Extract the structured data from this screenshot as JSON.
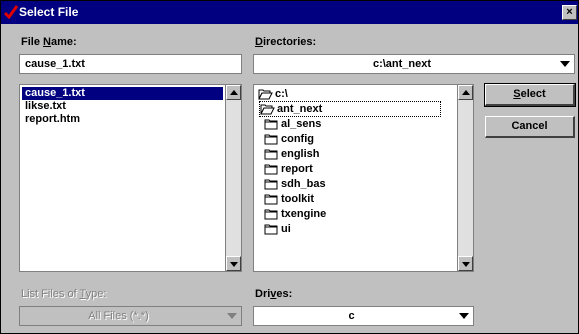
{
  "window": {
    "title": "Select File",
    "close_glyph": "×"
  },
  "file_name": {
    "label_pre": "File ",
    "label_key": "N",
    "label_post": "ame:",
    "value": "cause_1.txt"
  },
  "directories": {
    "label_key": "D",
    "label_post": "irectories:",
    "current": "c:\\ant_next"
  },
  "files": [
    "cause_1.txt",
    "likse.txt",
    "report.htm"
  ],
  "selected_file_index": 0,
  "dir_tree": {
    "root": "c:\\",
    "current": "ant_next",
    "children": [
      "al_sens",
      "config",
      "english",
      "report",
      "sdh_bas",
      "toolkit",
      "txengine",
      "ui"
    ]
  },
  "buttons": {
    "select_key": "S",
    "select_rest": "elect",
    "cancel": "Cancel"
  },
  "file_type": {
    "label_pre": "List Files of ",
    "label_key": "T",
    "label_post": "ype:",
    "value": "All Files (*.*)"
  },
  "drives": {
    "label_pre": "Dri",
    "label_key": "v",
    "label_post": "es:",
    "value": "c"
  },
  "icons": {
    "title": "checkmark-icon",
    "folder_open": "open-folder-icon",
    "folder": "folder-icon",
    "arrow": "triangle-arrow-icon"
  }
}
